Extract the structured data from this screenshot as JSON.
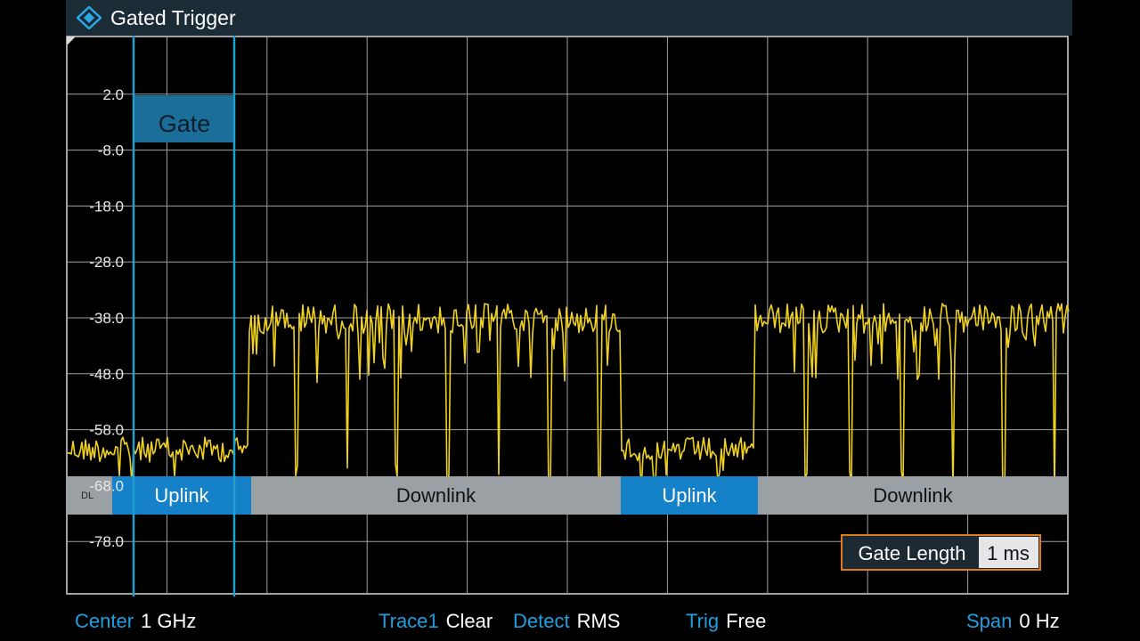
{
  "app": {
    "title": "Gated Trigger",
    "logo_icon": "rs-diamond-logo-icon"
  },
  "display": {
    "y_axis_labels": [
      "2.0",
      "-8.0",
      "-18.0",
      "-28.0",
      "-38.0",
      "-48.0",
      "-58.0",
      "-68.0",
      "-78.0"
    ],
    "gate_label": "Gate",
    "frame_label": "DL",
    "segments": [
      {
        "label": "Uplink",
        "type": "uplink"
      },
      {
        "label": "Downlink",
        "type": "downlink"
      },
      {
        "label": "Uplink",
        "type": "uplink"
      },
      {
        "label": "Downlink",
        "type": "downlink"
      }
    ],
    "gate_length": {
      "label": "Gate Length",
      "value": "1 ms"
    }
  },
  "status": {
    "center": {
      "label": "Center",
      "value": "1 GHz"
    },
    "trace": {
      "label": "Trace1",
      "value": "Clear"
    },
    "detect": {
      "label": "Detect",
      "value": "RMS"
    },
    "trig": {
      "label": "Trig",
      "value": "Free"
    },
    "span": {
      "label": "Span",
      "value": "0 Hz"
    }
  },
  "colors": {
    "trace": "#f0d21c",
    "gate_line": "#20a0d0",
    "uplink": "#1481c8",
    "downlink": "#9aa0a4",
    "accent_text": "#1f9fe0",
    "gate_box": "#1c6e9a",
    "gate_length_border": "#e07a20"
  }
}
